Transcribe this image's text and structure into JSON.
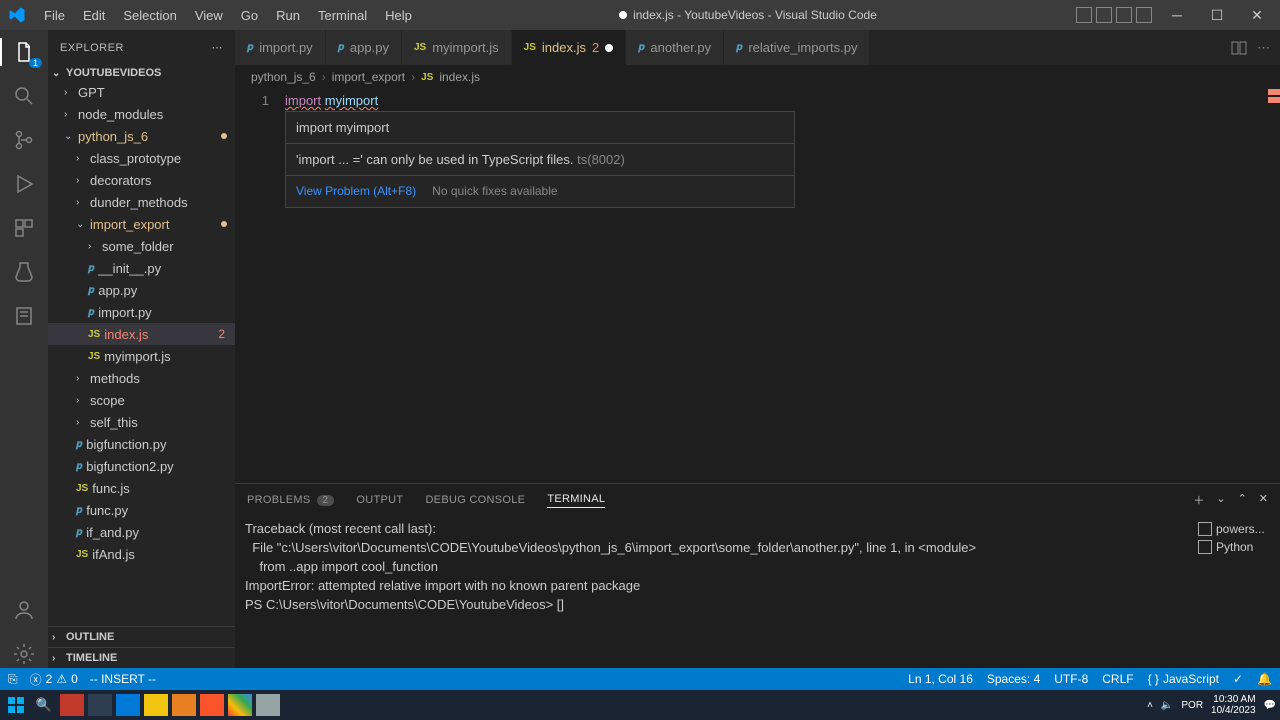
{
  "window": {
    "title": "index.js - YoutubeVideos - Visual Studio Code"
  },
  "menu": [
    "File",
    "Edit",
    "Selection",
    "View",
    "Go",
    "Run",
    "Terminal",
    "Help"
  ],
  "activity_badge": "1",
  "sidebar": {
    "header": "EXPLORER",
    "workspace": "YOUTUBEVIDEOS",
    "tree": {
      "gpt": "GPT",
      "node_modules": "node_modules",
      "python_js_6": "python_js_6",
      "class_prototype": "class_prototype",
      "decorators": "decorators",
      "dunder_methods": "dunder_methods",
      "import_export": "import_export",
      "some_folder": "some_folder",
      "init_py": "__init__.py",
      "app_py": "app.py",
      "import_py": "import.py",
      "index_js": "index.js",
      "index_js_problems": "2",
      "myimport_js": "myimport.js",
      "methods": "methods",
      "scope": "scope",
      "self_this": "self_this",
      "bigfunction_py": "bigfunction.py",
      "bigfunction2_py": "bigfunction2.py",
      "func_js": "func.js",
      "func_py": "func.py",
      "if_and_py": "if_and.py",
      "ifAnd_js": "ifAnd.js"
    },
    "outline": "OUTLINE",
    "timeline": "TIMELINE"
  },
  "tabs": [
    {
      "label": "import.py",
      "icon": "py"
    },
    {
      "label": "app.py",
      "icon": "py"
    },
    {
      "label": "myimport.js",
      "icon": "js"
    },
    {
      "label": "index.js",
      "icon": "js",
      "count": "2",
      "active": true,
      "dirty": true
    },
    {
      "label": "another.py",
      "icon": "py"
    },
    {
      "label": "relative_imports.py",
      "icon": "py"
    }
  ],
  "breadcrumb": {
    "a": "python_js_6",
    "b": "import_export",
    "c": "index.js"
  },
  "code": {
    "line1_num": "1",
    "line1_kw": "import",
    "line1_id": "myimport"
  },
  "hover": {
    "line1_kw": "import",
    "line1_id": "myimport",
    "message": "'import ... =' can only be used in TypeScript files.",
    "code": "ts(8002)",
    "view_problem": "View Problem (Alt+F8)",
    "no_fix": "No quick fixes available"
  },
  "panel": {
    "problems": "PROBLEMS",
    "problems_count": "2",
    "output": "OUTPUT",
    "debug": "DEBUG CONSOLE",
    "terminal": "TERMINAL"
  },
  "terminal_lines": [
    "Traceback (most recent call last):",
    "  File \"c:\\Users\\vitor\\Documents\\CODE\\YoutubeVideos\\python_js_6\\import_export\\some_folder\\another.py\", line 1, in <module>",
    "    from ..app import cool_function",
    "ImportError: attempted relative import with no known parent package",
    "PS C:\\Users\\vitor\\Documents\\CODE\\YoutubeVideos> []"
  ],
  "terminal_sidebar": {
    "powers": "powers...",
    "python": "Python"
  },
  "statusbar": {
    "errors": "2",
    "warnings": "0",
    "mode": "-- INSERT --",
    "pos": "Ln 1, Col 16",
    "spaces": "Spaces: 4",
    "encoding": "UTF-8",
    "eol": "CRLF",
    "lang": "JavaScript"
  },
  "taskbar": {
    "time": "10:30 AM",
    "date": "10/4/2023",
    "lang": "POR"
  }
}
